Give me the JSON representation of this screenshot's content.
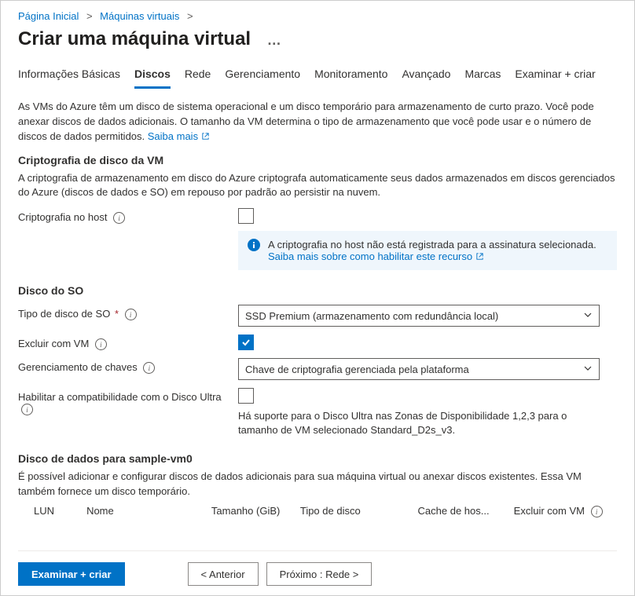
{
  "breadcrumb": {
    "home": "Página Inicial",
    "vms": "Máquinas virtuais"
  },
  "title": "Criar uma máquina virtual",
  "tabs": [
    "Informações Básicas",
    "Discos",
    "Rede",
    "Gerenciamento",
    "Monitoramento",
    "Avançado",
    "Marcas",
    "Examinar + criar"
  ],
  "intro": {
    "text": "As VMs do Azure têm um disco de sistema operacional e um disco temporário para armazenamento de curto prazo. Você pode anexar discos de dados adicionais. O tamanho da VM determina o tipo de armazenamento que você pode usar e o número de discos de dados permitidos. ",
    "learn_more": "Saiba mais"
  },
  "encryption": {
    "heading": "Criptografia de disco da VM",
    "desc": "A criptografia de armazenamento em disco do Azure criptografa automaticamente seus dados armazenados em discos gerenciados do Azure (discos de dados e SO) em repouso por padrão ao persistir na nuvem.",
    "host_label": "Criptografia no host",
    "notice_text": "A criptografia no host não está registrada para a assinatura selecionada.",
    "notice_link": "Saiba mais sobre como habilitar este recurso"
  },
  "os_disk": {
    "heading": "Disco do SO",
    "type_label": "Tipo de disco de SO",
    "type_value": "SSD Premium (armazenamento com redundância local)",
    "delete_label": "Excluir com VM",
    "key_label": "Gerenciamento de chaves",
    "key_value": "Chave de criptografia gerenciada pela plataforma",
    "ultra_label": "Habilitar a compatibilidade com o Disco Ultra",
    "ultra_note": "Há suporte para o Disco Ultra nas Zonas de Disponibilidade 1,2,3 para o tamanho de VM selecionado Standard_D2s_v3."
  },
  "data_disk": {
    "heading": "Disco de dados para sample-vm0",
    "desc": "É possível adicionar e configurar discos de dados adicionais para sua máquina virtual ou anexar discos existentes. Essa VM também fornece um disco temporário.",
    "cols": {
      "lun": "LUN",
      "name": "Nome",
      "size": "Tamanho (GiB)",
      "type": "Tipo de disco",
      "cache": "Cache de hos...",
      "delete": "Excluir com VM"
    }
  },
  "footer": {
    "review": "Examinar + criar",
    "prev": "< Anterior",
    "next": "Próximo : Rede >"
  }
}
